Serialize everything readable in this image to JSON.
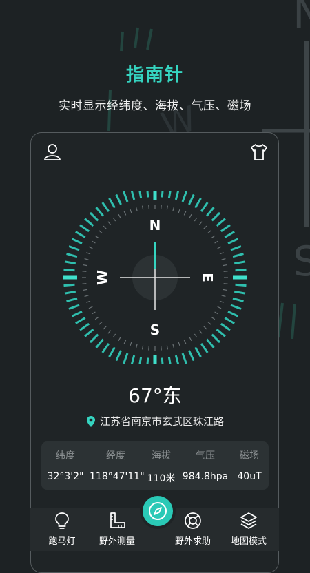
{
  "header": {
    "title": "指南针",
    "subtitle": "实时显示经纬度、海拔、气压、磁场"
  },
  "compass": {
    "north": "N",
    "east": "E",
    "south": "S",
    "west": "W",
    "heading_text": "67°东"
  },
  "location": {
    "address": "江苏省南京市玄武区珠江路"
  },
  "stats": [
    {
      "label": "纬度",
      "value": "32°3'2\""
    },
    {
      "label": "经度",
      "value": "118°47'11\""
    },
    {
      "label": "海拔",
      "value": "110米"
    },
    {
      "label": "气压",
      "value": "984.8hpa"
    },
    {
      "label": "磁场",
      "value": "40uT"
    }
  ],
  "nav": [
    {
      "label": "跑马灯",
      "icon": "lightbulb-icon"
    },
    {
      "label": "野外测量",
      "icon": "ruler-icon"
    },
    {
      "label": "野外求助",
      "icon": "lifebuoy-icon"
    },
    {
      "label": "地图模式",
      "icon": "layers-icon"
    }
  ],
  "colors": {
    "accent": "#35d4c0",
    "background": "#1d2224",
    "card": "#1f2426",
    "stats_bg": "#2c3234"
  }
}
